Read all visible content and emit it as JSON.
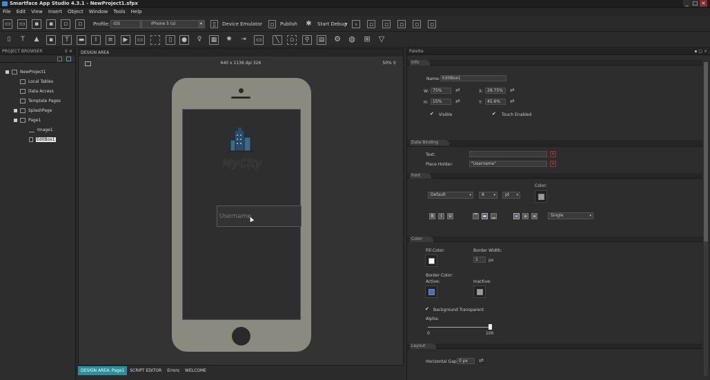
{
  "window": {
    "title": "Smartface App Studio 4.3.1 - NewProject1.sfpx",
    "controls": [
      "_",
      "□",
      "×"
    ]
  },
  "menu": [
    "File",
    "Edit",
    "View",
    "Insert",
    "Object",
    "Window",
    "Tools",
    "Help"
  ],
  "toolbar": {
    "profile_label": "Profile:",
    "profile_value": "iOS",
    "device_value": "iPhone 5  (s)",
    "device_emulator_label": "Device Emulator",
    "publish_label": "Publish",
    "start_debug_label": "Start Debug"
  },
  "project_browser": {
    "header": "PROJECT BROWSER",
    "header_buttons": "⚲ ✕",
    "tree": [
      {
        "label": "NewProject1"
      },
      {
        "label": "Local Tables"
      },
      {
        "label": "Data Access"
      },
      {
        "label": "Template Pages"
      },
      {
        "label": "SplashPage"
      },
      {
        "label": "Page1"
      },
      {
        "label": "Image1"
      },
      {
        "label": "EditBox1"
      }
    ]
  },
  "design_area": {
    "header": "DESIGN AREA",
    "resolution": "640 x 1136 dpi 326",
    "zoom": "50%",
    "app_logo_text": "MyCity",
    "username_placeholder": "Username",
    "bottom_tabs": [
      "DESIGN AREA: Page1",
      "SCRIPT EDITOR",
      "Errors",
      "WELCOME"
    ]
  },
  "palette": {
    "header": "Palette",
    "header_buttons": "▪ □ ×",
    "info": {
      "tab": "Info",
      "name_label": "Name:",
      "name_value": "EditBox1",
      "w_label": "W:",
      "w_value": "75%",
      "x_label": "X:",
      "x_value": "28.75%",
      "h_label": "H:",
      "h_value": "15%",
      "y_label": "Y:",
      "y_value": "45.6%",
      "visible_label": "Visible",
      "touch_label": "Touch Enabled"
    },
    "data_binding": {
      "tab": "Data Binding",
      "text_label": "Text:",
      "text_value": "",
      "placeholder_label": "Place Holder:",
      "placeholder_value": "\"Username\""
    },
    "font": {
      "tab": "Font",
      "family": "Default",
      "size": "8",
      "unit": "pt",
      "color_label": "Color:",
      "line_mode": "Single"
    },
    "color": {
      "tab": "Color",
      "fill_label": "Fill Color:",
      "border_width_label": "Border Width:",
      "border_width_value": "1",
      "border_width_unit": "px",
      "border_color_label": "Border Color:",
      "active_label": "Active:",
      "inactive_label": "Inactive:",
      "bg_transparent_label": "Background Transparent",
      "alpha_label": "Alpha:",
      "alpha_min": "0",
      "alpha_max": "100",
      "alpha_value": 100,
      "fill_color": "#ffffff",
      "active_color": "#3a6fd8",
      "inactive_color": "#9a9a9a"
    },
    "layout": {
      "tab": "Layout",
      "hgap_label": "Horizontal Gap:",
      "hgap_value": "0 px"
    }
  },
  "colors": {
    "accent_tab": "#2a8f9e",
    "delete_red": "#dd4444"
  }
}
